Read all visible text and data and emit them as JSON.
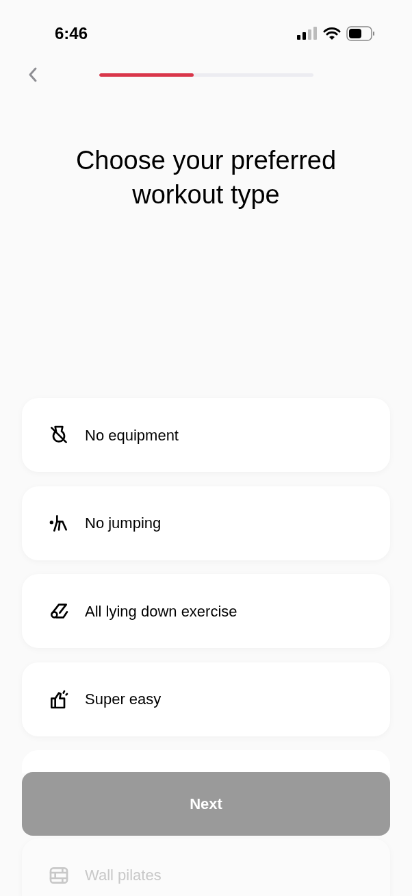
{
  "status_bar": {
    "time": "6:46"
  },
  "progress": {
    "level": 0.44
  },
  "title": "Choose your preferred workout type",
  "options": [
    {
      "kind": "equipment",
      "label": "No equipment",
      "faded": false
    },
    {
      "kind": "jumping",
      "label": "No jumping",
      "faded": false
    },
    {
      "kind": "lying",
      "label": "All lying down exercise",
      "faded": false
    },
    {
      "kind": "easy",
      "label": "Super easy",
      "faded": false
    },
    {
      "kind": "hidden"
    },
    {
      "kind": "wall",
      "label": "Wall pilates",
      "faded": true
    }
  ],
  "next_button": {
    "label": "Next",
    "disabled": true
  }
}
